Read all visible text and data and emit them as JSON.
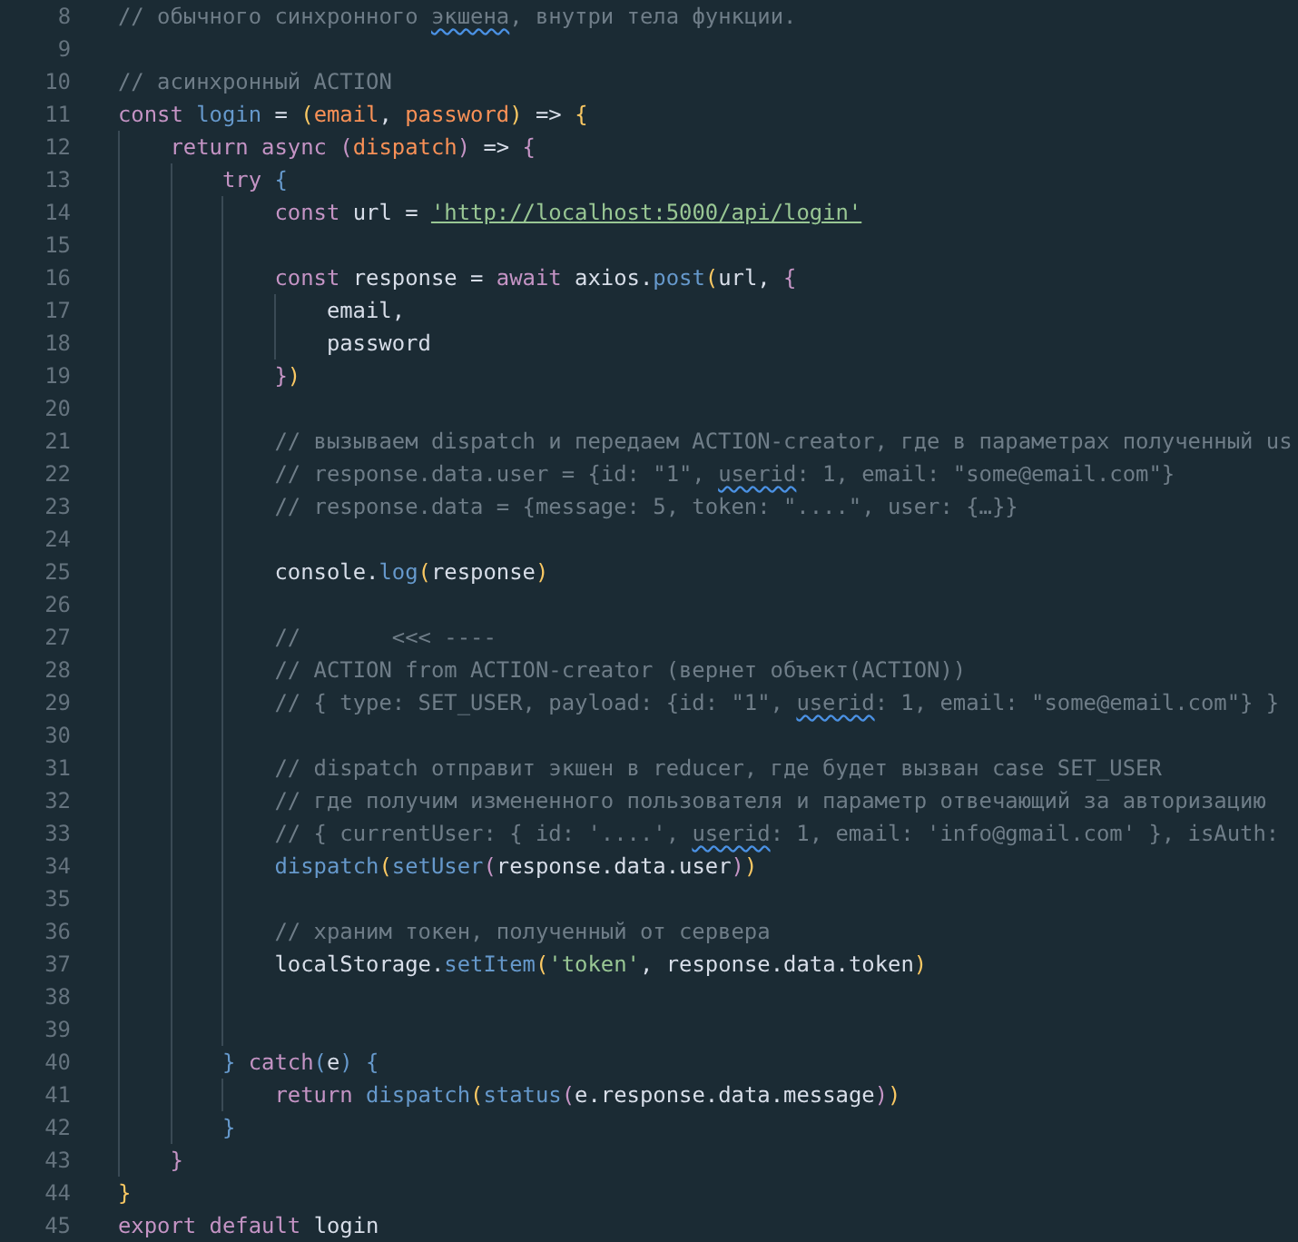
{
  "editor": {
    "lines": [
      {
        "number": "8",
        "tokens": [
          {
            "kind": "comment",
            "text": "// обычного синхронного "
          },
          {
            "kind": "comment",
            "text": "экшена",
            "misspelled": true
          },
          {
            "kind": "comment",
            "text": ", внутри тела функции."
          }
        ]
      },
      {
        "number": "9"
      },
      {
        "number": "10",
        "tokens": [
          {
            "kind": "comment",
            "text": "// асинхронный ACTION"
          }
        ]
      },
      {
        "number": "11",
        "tokens": [
          {
            "kind": "keyword",
            "text": "const "
          },
          {
            "kind": "function",
            "text": "login"
          },
          {
            "kind": "plain",
            "text": " = "
          },
          {
            "kind": "brace",
            "text": "("
          },
          {
            "kind": "param",
            "text": "email"
          },
          {
            "kind": "plain",
            "text": ", "
          },
          {
            "kind": "param",
            "text": "password"
          },
          {
            "kind": "brace",
            "text": ")"
          },
          {
            "kind": "plain",
            "text": " => "
          },
          {
            "kind": "brace",
            "text": "{"
          }
        ]
      },
      {
        "number": "12",
        "guides": [
          {
            "kind": "indent"
          }
        ],
        "tokens": [
          {
            "kind": "keyword",
            "text": "return async "
          },
          {
            "kind": "paren",
            "text": "("
          },
          {
            "kind": "param",
            "text": "dispatch"
          },
          {
            "kind": "paren",
            "text": ")"
          },
          {
            "kind": "plain",
            "text": " => "
          },
          {
            "kind": "paren",
            "text": "{"
          }
        ]
      },
      {
        "number": "13",
        "guides": [
          {
            "kind": "indent"
          },
          {
            "kind": "indent"
          }
        ],
        "tokens": [
          {
            "kind": "keyword",
            "text": "try "
          },
          {
            "kind": "function",
            "text": "{"
          }
        ]
      },
      {
        "number": "14",
        "guides": [
          {
            "kind": "indent"
          },
          {
            "kind": "indent"
          },
          {
            "kind": "indent"
          }
        ],
        "tokens": [
          {
            "kind": "keyword",
            "text": "const "
          },
          {
            "kind": "plain",
            "text": "url = "
          },
          {
            "kind": "url",
            "text": "'http://localhost:5000/api/login'"
          }
        ]
      },
      {
        "number": "15",
        "guides": [
          {
            "kind": "indent"
          },
          {
            "kind": "indent"
          },
          {
            "kind": "indent"
          }
        ]
      },
      {
        "number": "16",
        "guides": [
          {
            "kind": "indent"
          },
          {
            "kind": "indent"
          },
          {
            "kind": "indent"
          }
        ],
        "tokens": [
          {
            "kind": "keyword",
            "text": "const "
          },
          {
            "kind": "plain",
            "text": "response = "
          },
          {
            "kind": "keyword",
            "text": "await "
          },
          {
            "kind": "plain",
            "text": "axios."
          },
          {
            "kind": "function",
            "text": "post"
          },
          {
            "kind": "brace",
            "text": "("
          },
          {
            "kind": "plain",
            "text": "url, "
          },
          {
            "kind": "paren",
            "text": "{"
          }
        ]
      },
      {
        "number": "17",
        "guides": [
          {
            "kind": "indent"
          },
          {
            "kind": "indent"
          },
          {
            "kind": "indent"
          },
          {
            "kind": "indent"
          }
        ],
        "tokens": [
          {
            "kind": "plain",
            "text": "email,"
          }
        ]
      },
      {
        "number": "18",
        "guides": [
          {
            "kind": "indent"
          },
          {
            "kind": "indent"
          },
          {
            "kind": "indent"
          },
          {
            "kind": "indent"
          }
        ],
        "tokens": [
          {
            "kind": "plain",
            "text": "password"
          }
        ]
      },
      {
        "number": "19",
        "guides": [
          {
            "kind": "indent"
          },
          {
            "kind": "indent"
          },
          {
            "kind": "indent"
          }
        ],
        "tokens": [
          {
            "kind": "paren",
            "text": "}"
          },
          {
            "kind": "brace",
            "text": ")"
          }
        ]
      },
      {
        "number": "20",
        "guides": [
          {
            "kind": "indent"
          },
          {
            "kind": "indent"
          },
          {
            "kind": "indent"
          }
        ]
      },
      {
        "number": "21",
        "guides": [
          {
            "kind": "indent"
          },
          {
            "kind": "indent"
          },
          {
            "kind": "indent"
          }
        ],
        "tokens": [
          {
            "kind": "comment",
            "text": "// вызываем dispatch и передаем ACTION-creator, где в параметрах полученный us"
          }
        ]
      },
      {
        "number": "22",
        "guides": [
          {
            "kind": "indent"
          },
          {
            "kind": "indent"
          },
          {
            "kind": "indent"
          }
        ],
        "tokens": [
          {
            "kind": "comment",
            "text": "// response.data.user = {id: \"1\", "
          },
          {
            "kind": "comment",
            "text": "userid",
            "misspelled": true
          },
          {
            "kind": "comment",
            "text": ": 1, email: \"some@email.com\"}"
          }
        ]
      },
      {
        "number": "23",
        "guides": [
          {
            "kind": "indent"
          },
          {
            "kind": "indent"
          },
          {
            "kind": "indent"
          }
        ],
        "tokens": [
          {
            "kind": "comment",
            "text": "// response.data = {message: 5, token: \"....\", user: {…}}"
          }
        ]
      },
      {
        "number": "24",
        "guides": [
          {
            "kind": "indent"
          },
          {
            "kind": "indent"
          },
          {
            "kind": "indent"
          }
        ]
      },
      {
        "number": "25",
        "guides": [
          {
            "kind": "indent"
          },
          {
            "kind": "indent"
          },
          {
            "kind": "indent"
          }
        ],
        "tokens": [
          {
            "kind": "plain",
            "text": "console."
          },
          {
            "kind": "function",
            "text": "log"
          },
          {
            "kind": "brace",
            "text": "("
          },
          {
            "kind": "plain",
            "text": "response"
          },
          {
            "kind": "brace",
            "text": ")"
          }
        ]
      },
      {
        "number": "26",
        "guides": [
          {
            "kind": "indent"
          },
          {
            "kind": "indent"
          },
          {
            "kind": "indent"
          }
        ]
      },
      {
        "number": "27",
        "guides": [
          {
            "kind": "indent"
          },
          {
            "kind": "indent"
          },
          {
            "kind": "indent"
          }
        ],
        "tokens": [
          {
            "kind": "comment",
            "text": "//       <<< ----"
          }
        ]
      },
      {
        "number": "28",
        "guides": [
          {
            "kind": "indent"
          },
          {
            "kind": "indent"
          },
          {
            "kind": "indent"
          }
        ],
        "tokens": [
          {
            "kind": "comment",
            "text": "// ACTION from ACTION-creator (вернет объект(ACTION))"
          }
        ]
      },
      {
        "number": "29",
        "guides": [
          {
            "kind": "indent"
          },
          {
            "kind": "indent"
          },
          {
            "kind": "indent"
          }
        ],
        "tokens": [
          {
            "kind": "comment",
            "text": "// { type: SET_USER, payload: {id: \"1\", "
          },
          {
            "kind": "comment",
            "text": "userid",
            "misspelled": true
          },
          {
            "kind": "comment",
            "text": ": 1, email: \"some@email.com\"} }"
          }
        ]
      },
      {
        "number": "30",
        "guides": [
          {
            "kind": "indent"
          },
          {
            "kind": "indent"
          },
          {
            "kind": "indent"
          }
        ]
      },
      {
        "number": "31",
        "guides": [
          {
            "kind": "indent"
          },
          {
            "kind": "indent"
          },
          {
            "kind": "indent"
          }
        ],
        "tokens": [
          {
            "kind": "comment",
            "text": "// dispatch отправит экшен в reducer, где будет вызван case SET_USER"
          }
        ]
      },
      {
        "number": "32",
        "guides": [
          {
            "kind": "indent"
          },
          {
            "kind": "indent"
          },
          {
            "kind": "indent"
          }
        ],
        "tokens": [
          {
            "kind": "comment",
            "text": "// где получим измененного пользователя и параметр отвечающий за авторизацию"
          }
        ]
      },
      {
        "number": "33",
        "guides": [
          {
            "kind": "indent"
          },
          {
            "kind": "indent"
          },
          {
            "kind": "indent"
          }
        ],
        "tokens": [
          {
            "kind": "comment",
            "text": "// { currentUser: { id: '....', "
          },
          {
            "kind": "comment",
            "text": "userid",
            "misspelled": true
          },
          {
            "kind": "comment",
            "text": ": 1, email: 'info@gmail.com' }, isAuth:"
          }
        ]
      },
      {
        "number": "34",
        "guides": [
          {
            "kind": "indent"
          },
          {
            "kind": "indent"
          },
          {
            "kind": "indent"
          }
        ],
        "tokens": [
          {
            "kind": "function",
            "text": "dispatch"
          },
          {
            "kind": "brace",
            "text": "("
          },
          {
            "kind": "function",
            "text": "setUser"
          },
          {
            "kind": "paren",
            "text": "("
          },
          {
            "kind": "plain",
            "text": "response.data.user"
          },
          {
            "kind": "paren",
            "text": ")"
          },
          {
            "kind": "brace",
            "text": ")"
          }
        ]
      },
      {
        "number": "35",
        "guides": [
          {
            "kind": "indent"
          },
          {
            "kind": "indent"
          },
          {
            "kind": "indent"
          }
        ]
      },
      {
        "number": "36",
        "guides": [
          {
            "kind": "indent"
          },
          {
            "kind": "indent"
          },
          {
            "kind": "indent"
          }
        ],
        "tokens": [
          {
            "kind": "comment",
            "text": "// храним токен, полученный от сервера"
          }
        ]
      },
      {
        "number": "37",
        "guides": [
          {
            "kind": "indent"
          },
          {
            "kind": "indent"
          },
          {
            "kind": "indent"
          }
        ],
        "tokens": [
          {
            "kind": "plain",
            "text": "localStorage."
          },
          {
            "kind": "function",
            "text": "setItem"
          },
          {
            "kind": "brace",
            "text": "("
          },
          {
            "kind": "string",
            "text": "'token'"
          },
          {
            "kind": "plain",
            "text": ", response.data.token"
          },
          {
            "kind": "brace",
            "text": ")"
          }
        ]
      },
      {
        "number": "38",
        "guides": [
          {
            "kind": "indent"
          },
          {
            "kind": "indent"
          },
          {
            "kind": "indent"
          }
        ]
      },
      {
        "number": "39",
        "guides": [
          {
            "kind": "indent"
          },
          {
            "kind": "indent"
          },
          {
            "kind": "indent"
          }
        ]
      },
      {
        "number": "40",
        "guides": [
          {
            "kind": "indent"
          },
          {
            "kind": "indent"
          }
        ],
        "tokens": [
          {
            "kind": "function",
            "text": "}"
          },
          {
            "kind": "keyword",
            "text": " catch"
          },
          {
            "kind": "function",
            "text": "("
          },
          {
            "kind": "plain",
            "text": "e"
          },
          {
            "kind": "function",
            "text": ") {"
          }
        ]
      },
      {
        "number": "41",
        "guides": [
          {
            "kind": "indent"
          },
          {
            "kind": "indent"
          },
          {
            "kind": "indent"
          }
        ],
        "tokens": [
          {
            "kind": "keyword",
            "text": "return "
          },
          {
            "kind": "function",
            "text": "dispatch"
          },
          {
            "kind": "brace",
            "text": "("
          },
          {
            "kind": "function",
            "text": "status"
          },
          {
            "kind": "paren",
            "text": "("
          },
          {
            "kind": "plain",
            "text": "e.response.data.message"
          },
          {
            "kind": "paren",
            "text": ")"
          },
          {
            "kind": "brace",
            "text": ")"
          }
        ]
      },
      {
        "number": "42",
        "guides": [
          {
            "kind": "indent"
          },
          {
            "kind": "indent"
          }
        ],
        "tokens": [
          {
            "kind": "function",
            "text": "}"
          }
        ]
      },
      {
        "number": "43",
        "guides": [
          {
            "kind": "indent"
          }
        ],
        "tokens": [
          {
            "kind": "paren",
            "text": "}"
          }
        ]
      },
      {
        "number": "44",
        "tokens": [
          {
            "kind": "brace",
            "text": "}"
          }
        ]
      },
      {
        "number": "45",
        "tokens": [
          {
            "kind": "keyword",
            "text": "export default "
          },
          {
            "kind": "plain",
            "text": "login"
          }
        ]
      }
    ]
  }
}
